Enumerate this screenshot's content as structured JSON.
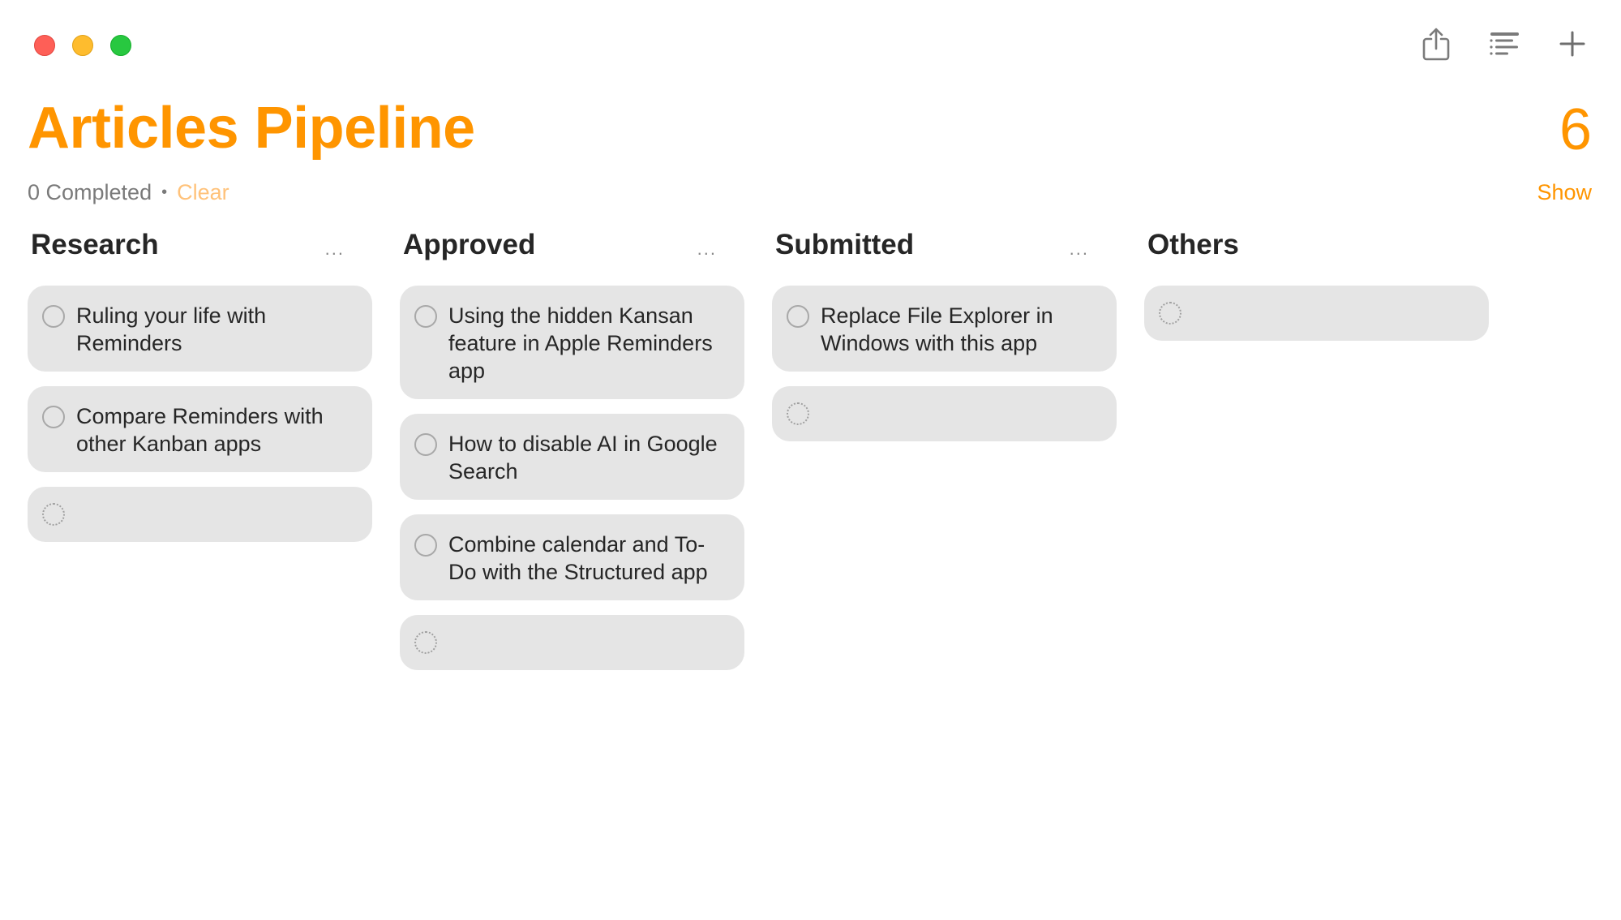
{
  "window": {
    "controls": [
      "close",
      "minimize",
      "maximize"
    ]
  },
  "toolbar": {
    "buttons": [
      {
        "name": "share",
        "icon": "share-icon"
      },
      {
        "name": "view-options",
        "icon": "list-icon"
      },
      {
        "name": "add",
        "icon": "plus-icon"
      }
    ]
  },
  "header": {
    "title": "Articles Pipeline",
    "count": "6",
    "completed_label": "0 Completed",
    "separator": "•",
    "clear_label": "Clear",
    "show_label": "Show"
  },
  "accent_color": "#ff9500",
  "columns": [
    {
      "title": "Research",
      "more": "...",
      "items": [
        "Ruling your life with Reminders",
        "Compare Reminders with other Kanban apps"
      ]
    },
    {
      "title": "Approved",
      "more": "...",
      "items": [
        "Using the hidden Kansan feature in Apple Reminders app",
        "How to disable AI in Google Search",
        "Combine calendar and To-Do with the Structured app"
      ]
    },
    {
      "title": "Submitted",
      "more": "...",
      "items": [
        "Replace File Explorer in Windows with this app"
      ]
    },
    {
      "title": "Others",
      "more": "",
      "items": []
    }
  ]
}
